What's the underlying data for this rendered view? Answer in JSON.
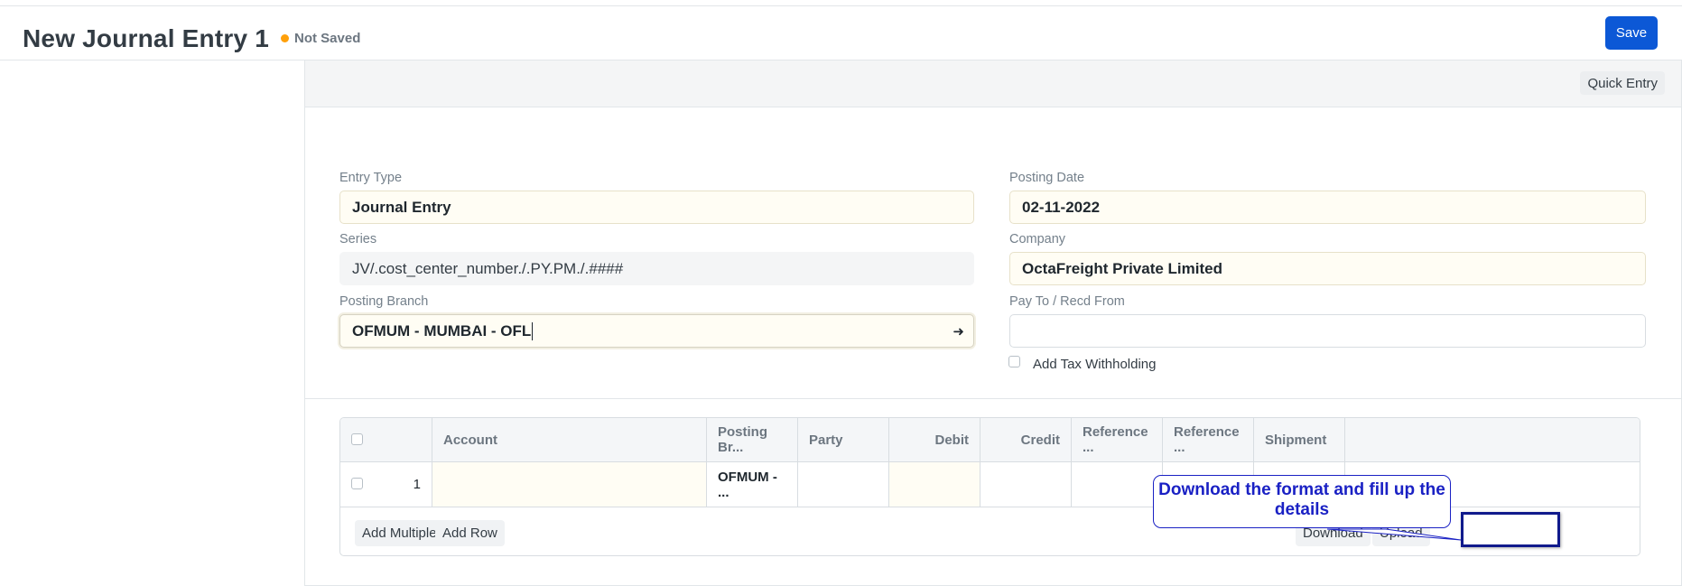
{
  "header": {
    "title": "New Journal Entry 1",
    "status": "Not Saved",
    "save_label": "Save"
  },
  "toolbar": {
    "quick_entry_label": "Quick Entry"
  },
  "fields": {
    "entry_type": {
      "label": "Entry Type",
      "value": "Journal Entry"
    },
    "series": {
      "label": "Series",
      "value": "JV/.cost_center_number./.PY.PM./.####"
    },
    "posting_branch": {
      "label": "Posting Branch",
      "value": "OFMUM - MUMBAI - OFL"
    },
    "posting_date": {
      "label": "Posting Date",
      "value": "02-11-2022"
    },
    "company": {
      "label": "Company",
      "value": "OctaFreight Private Limited"
    },
    "pay_to": {
      "label": "Pay To / Recd From",
      "value": ""
    },
    "tax_withholding": {
      "label": "Add Tax Withholding",
      "checked": false
    }
  },
  "accounts_table": {
    "columns": [
      "Account",
      "Posting Br...",
      "Party",
      "Debit",
      "Credit",
      "Reference ...",
      "Reference ...",
      "Shipment"
    ],
    "rows": [
      {
        "idx": "1",
        "account": "",
        "posting_branch": "OFMUM - ...",
        "party": "",
        "debit": "",
        "credit": "",
        "ref1": "",
        "ref2": "",
        "shipment": ""
      }
    ],
    "buttons": {
      "add_multiple": "Add Multiple",
      "add_row": "Add Row",
      "download": "Download",
      "upload": "Upload"
    }
  },
  "annotation": {
    "callout_text": "Download the format and fill up the details",
    "color": "#1a21c4"
  },
  "colors": {
    "primary": "#0c58d6",
    "status_dot": "#ffa00a",
    "input_highlight": "#fffdf4"
  }
}
